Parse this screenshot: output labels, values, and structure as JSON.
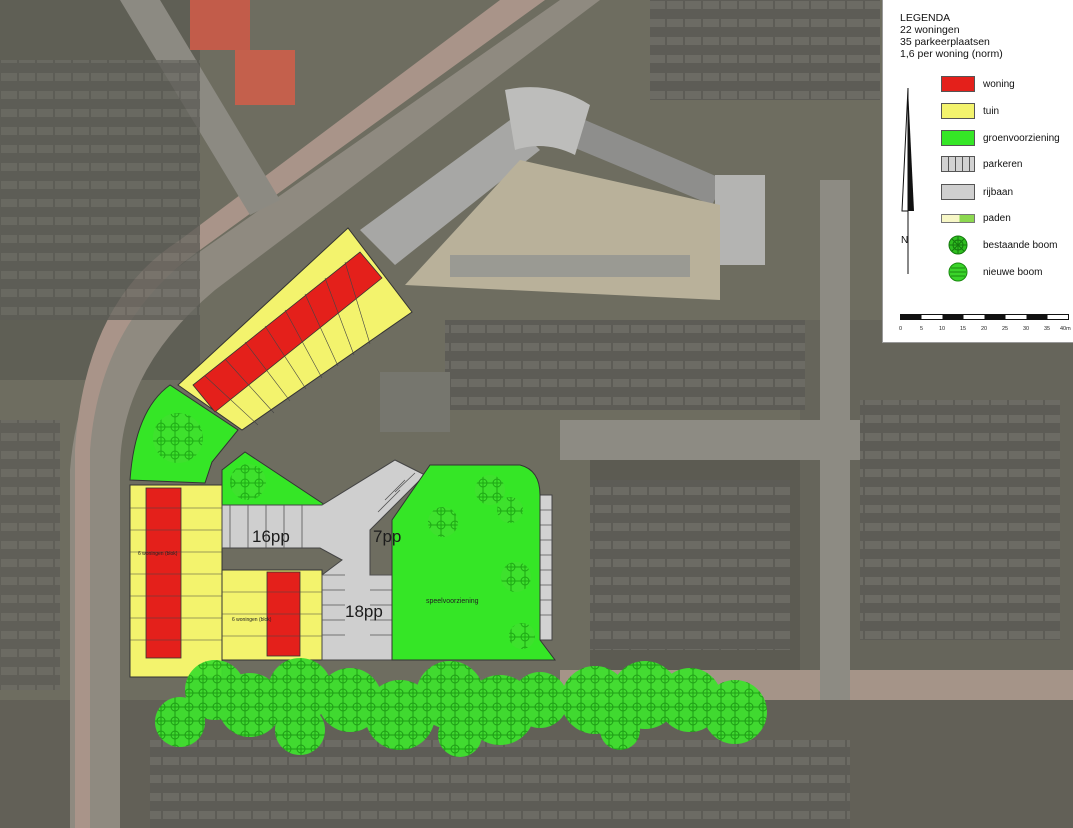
{
  "map": {
    "labels": {
      "parking_16": "16pp",
      "parking_7": "7pp",
      "parking_18": "18pp",
      "playground": "speelvoorziening",
      "woningen_west": "6 woningen (blok)",
      "woningen_south": "6 woningen (blok)"
    }
  },
  "legend": {
    "title": "LEGENDA",
    "lines": [
      "22 woningen",
      "35 parkeerplaatsen",
      "1,6 per woning (norm)"
    ],
    "items": [
      {
        "label": "woning",
        "swatch": "red",
        "color": "#e4201b"
      },
      {
        "label": "tuin",
        "swatch": "yellow",
        "color": "#f3f36d"
      },
      {
        "label": "groenvoorziening",
        "swatch": "green",
        "color": "#35e626"
      },
      {
        "label": "parkeren",
        "swatch": "parking-stalls"
      },
      {
        "label": "rijbaan",
        "swatch": "grey",
        "color": "#cfcfcf"
      },
      {
        "label": "paden",
        "swatch": "path"
      },
      {
        "label": "bestaande boom",
        "swatch": "tree-existing",
        "color": "#2fbf20"
      },
      {
        "label": "nieuwe boom",
        "swatch": "tree-new",
        "color": "#3ad42a"
      }
    ],
    "north_label": "N",
    "scale_labels": [
      "0",
      "5",
      "10",
      "15",
      "20",
      "25",
      "30",
      "35",
      "40m"
    ]
  }
}
